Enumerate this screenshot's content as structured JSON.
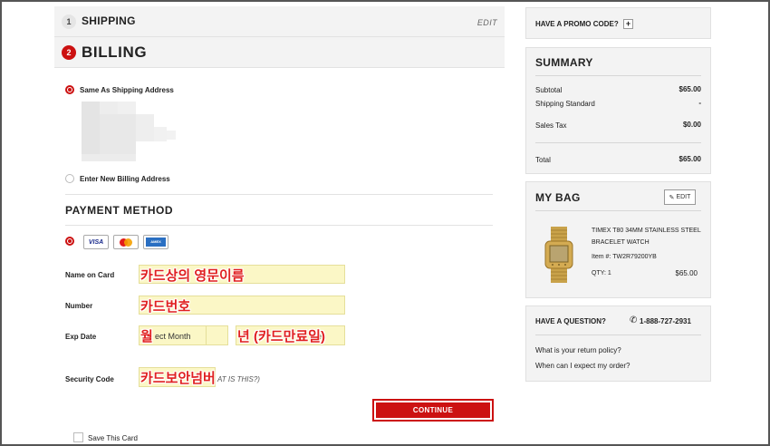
{
  "steps": {
    "shipping": {
      "number": "1",
      "title": "SHIPPING",
      "edit": "EDIT"
    },
    "billing": {
      "number": "2",
      "title": "BILLING"
    }
  },
  "billing_address": {
    "same_as_shipping": "Same As Shipping Address",
    "enter_new": "Enter New Billing Address"
  },
  "payment": {
    "title": "PAYMENT METHOD",
    "cards": [
      "VISA",
      "mastercard",
      "AMERICAN EXPRESS"
    ],
    "name_label": "Name on Card",
    "name_overlay": "카드상의 영문이름",
    "number_label": "Number",
    "number_overlay": "카드번호",
    "exp_label": "Exp Date",
    "month_overlay": "월",
    "month_select": "ect Month",
    "year_overlay": "년 (카드만료일)",
    "year_select_fragment": "ec",
    "security_label": "Security Code",
    "security_overlay": "카드보안넘버",
    "security_hint": "AT IS THIS?)",
    "continue": "CONTINUE",
    "save_card": "Save This Card"
  },
  "promo": {
    "title": "HAVE A PROMO CODE?",
    "plus": "+"
  },
  "summary": {
    "title": "SUMMARY",
    "subtotal_label": "Subtotal",
    "subtotal": "$65.00",
    "shipping_label": "Shipping Standard",
    "shipping": "-",
    "tax_label": "Sales Tax",
    "tax": "$0.00",
    "total_label": "Total",
    "total": "$65.00"
  },
  "bag": {
    "title": "MY BAG",
    "edit": "EDIT",
    "item_name_1": "TIMEX T80 34MM STAINLESS STEEL",
    "item_name_2": "BRACELET WATCH",
    "item_number": "Item #: TW2R79200YB",
    "qty": "QTY: 1",
    "price": "$65.00"
  },
  "question": {
    "title": "HAVE A QUESTION?",
    "phone": "1-888-727-2931",
    "link1": "What is your return policy?",
    "link2": "When can I expect my order?"
  },
  "colors": {
    "accent": "#cc1111",
    "field_bg": "#fbf7c6",
    "overlay_text": "#e02020"
  }
}
